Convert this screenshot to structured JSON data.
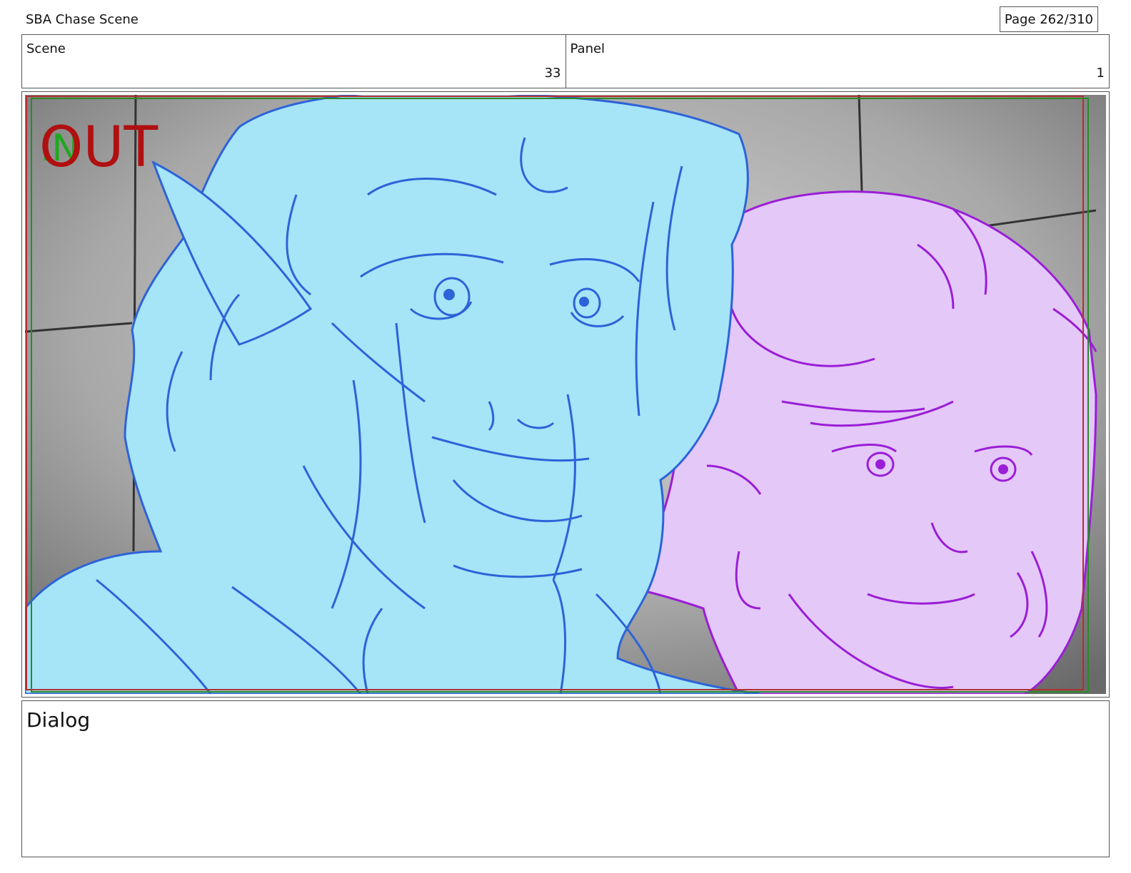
{
  "document": {
    "title": "SBA Chase Scene",
    "page": "Page 262/310"
  },
  "scene": {
    "label": "Scene",
    "value": "33"
  },
  "panel": {
    "label": "Panel",
    "value": "1"
  },
  "frame_overlay": {
    "in_marker": "IN",
    "out_marker": "OUT",
    "in_color": "#1fa81f",
    "out_color": "#b01010"
  },
  "colors": {
    "left_character_fill": "#a6e4f8",
    "left_character_line": "#2d63d8",
    "right_character_fill": "#e4c8f8",
    "right_character_line": "#9a1ed6",
    "background_gray": "#9a9a9a"
  },
  "dialog": {
    "label": "Dialog",
    "text": ""
  }
}
